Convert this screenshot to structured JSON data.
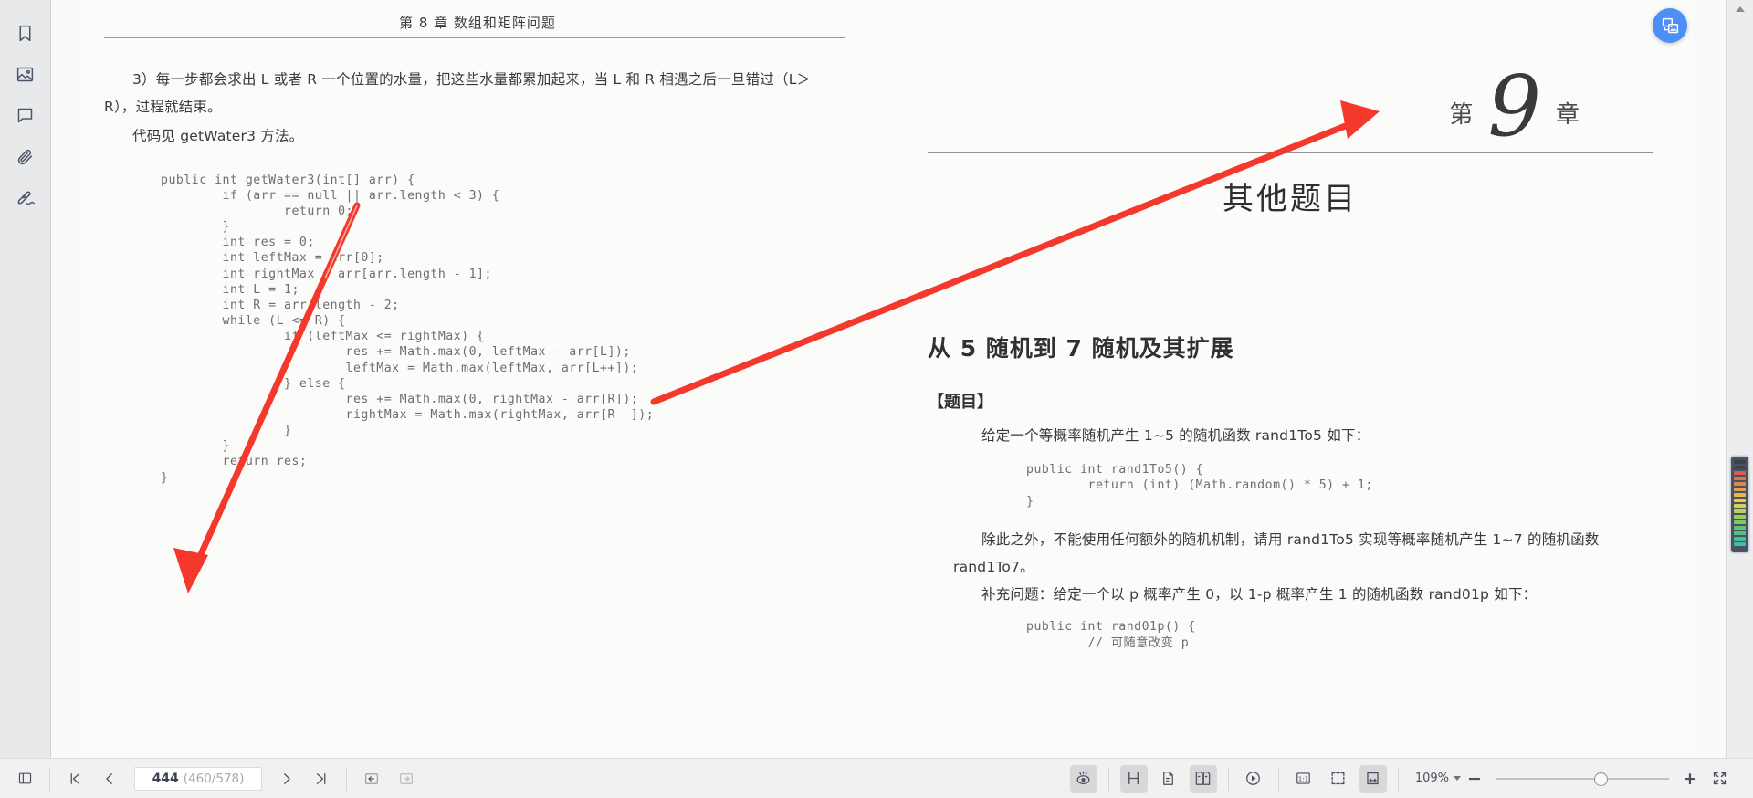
{
  "left_rail": {
    "items": [
      {
        "name": "bookmark-icon",
        "label": "Bookmarks"
      },
      {
        "name": "thumbnails-icon",
        "label": "Thumbnails"
      },
      {
        "name": "comments-icon",
        "label": "Comments"
      },
      {
        "name": "attachments-icon",
        "label": "Attachments"
      },
      {
        "name": "signature-icon",
        "label": "Signatures"
      }
    ]
  },
  "fab": {
    "name": "convert-to-image-button",
    "title": "Convert"
  },
  "document": {
    "left_page": {
      "running_head": "第 8 章   数组和矩阵问题",
      "paragraph_1": "3）每一步都会求出 L 或者 R 一个位置的水量，把这些水量都累加起来，当 L 和 R 相遇之后一旦错过（L＞R），过程就结束。",
      "paragraph_2": "代码见 getWater3 方法。",
      "code": "public int getWater3(int[] arr) {\n        if (arr == null || arr.length < 3) {\n                return 0;\n        }\n        int res = 0;\n        int leftMax = arr[0];\n        int rightMax = arr[arr.length - 1];\n        int L = 1;\n        int R = arr.length - 2;\n        while (L <= R) {\n                if (leftMax <= rightMax) {\n                        res += Math.max(0, leftMax - arr[L]);\n                        leftMax = Math.max(leftMax, arr[L++]);\n                } else {\n                        res += Math.max(0, rightMax - arr[R]);\n                        rightMax = Math.max(rightMax, arr[R--]);\n                }\n        }\n        return res;\n}"
    },
    "right_page": {
      "chapter_prefix": "第",
      "chapter_number": "9",
      "chapter_suffix": "章",
      "chapter_title": "其他题目",
      "section_title": "从 5 随机到 7 随机及其扩展",
      "subsection_title": "【题目】",
      "paragraph_1": "给定一个等概率随机产生 1~5 的随机函数 rand1To5 如下：",
      "code_1": "public int rand1To5() {\n        return (int) (Math.random() * 5) + 1;\n}",
      "paragraph_2": "除此之外，不能使用任何额外的随机机制，请用 rand1To5 实现等概率随机产生 1~7 的随机函数 rand1To7。",
      "paragraph_3": "补充问题：给定一个以 p 概率产生 0，以 1-p 概率产生 1 的随机函数 rand01p 如下：",
      "code_2": "public int rand01p() {\n        // 可随意改变 p"
    }
  },
  "minimap": {
    "name": "heatmap-scrollbar",
    "segments": [
      "#39404e",
      "#3d4452",
      "#e05a4a",
      "#e2734a",
      "#e3854c",
      "#e5a04e",
      "#e7b94f",
      "#e8cc50",
      "#d9d256",
      "#bcd05c",
      "#9ccd63",
      "#7dc96a",
      "#62c574",
      "#4fc283",
      "#45bf93",
      "#45bda4"
    ]
  },
  "toolbar": {
    "sidebar_toggle": {
      "name": "toggle-sidebar-button",
      "title": "Toggle sidebar"
    },
    "nav": {
      "first": {
        "name": "first-page-button",
        "title": "First page"
      },
      "prev": {
        "name": "previous-page-button",
        "title": "Previous page"
      },
      "next": {
        "name": "next-page-button",
        "title": "Next page"
      },
      "last": {
        "name": "last-page-button",
        "title": "Last page"
      }
    },
    "page_current": "444",
    "page_total": "(460/578)",
    "history": {
      "back": {
        "name": "go-back-button",
        "title": "Back"
      },
      "forward": {
        "name": "go-forward-button",
        "title": "Forward",
        "disabled": true
      }
    },
    "view_modes": {
      "reading": {
        "name": "reading-mode-button",
        "title": "Reading mode",
        "active": true
      },
      "scroll_horizontal": {
        "name": "horizontal-scroll-button",
        "title": "Horizontal scrolling",
        "active": true
      },
      "single_page": {
        "name": "single-page-button",
        "title": "Single page"
      },
      "double_page": {
        "name": "double-page-button",
        "title": "Double page",
        "active": true
      },
      "presentation": {
        "name": "presentation-mode-button",
        "title": "Presentation"
      }
    },
    "fit": {
      "actual_size": {
        "name": "actual-size-button",
        "title": "Actual size",
        "label": "1:1"
      },
      "fit_page": {
        "name": "fit-page-button",
        "title": "Fit page"
      },
      "fit_width": {
        "name": "fit-width-button",
        "title": "Fit width",
        "active": true
      }
    },
    "zoom_level": "109%",
    "zoom_out": {
      "name": "zoom-out-button",
      "label": "−"
    },
    "zoom_in": {
      "name": "zoom-in-button",
      "label": "+"
    },
    "fullscreen": {
      "name": "fullscreen-button",
      "title": "Full screen"
    }
  }
}
